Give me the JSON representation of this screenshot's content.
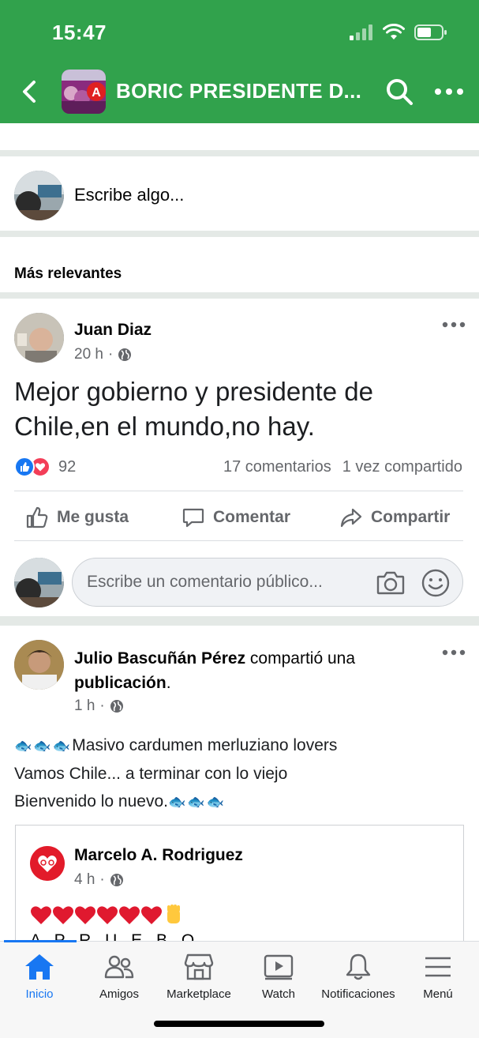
{
  "status_bar": {
    "time": "15:47"
  },
  "header": {
    "group_title": "BORIC PRESIDENTE D..."
  },
  "composer": {
    "placeholder": "Escribe algo..."
  },
  "feed": {
    "section_title": "Más relevantes"
  },
  "post1": {
    "author": "Juan Diaz",
    "time": "20 h",
    "text": "Mejor gobierno y presidente de Chile,en el mundo,no hay.",
    "reaction_count": "92",
    "comments": "17 comentarios",
    "shares": "1 vez compartido"
  },
  "actions": {
    "like": "Me gusta",
    "comment": "Comentar",
    "share": "Compartir"
  },
  "comment_box": {
    "placeholder": "Escribe un comentario público..."
  },
  "post2": {
    "author": "Julio Bascuñán Pérez",
    "shared_text": "compartió una",
    "shared_object": "publicación",
    "time": "1 h",
    "line1": "Masivo  cardumen merluziano lovers",
    "line2": "Vamos Chile... a terminar con lo viejo",
    "line3": "Bienvenido lo nuevo."
  },
  "shared_post": {
    "author": "Marcelo A. Rodriguez",
    "time": "4 h",
    "text": "A P R U E B O"
  },
  "tabbar": {
    "tabs": [
      {
        "label": "Inicio",
        "icon": "home-icon",
        "active": true
      },
      {
        "label": "Amigos",
        "icon": "friends-icon"
      },
      {
        "label": "Marketplace",
        "icon": "marketplace-icon"
      },
      {
        "label": "Watch",
        "icon": "watch-icon"
      },
      {
        "label": "Notificaciones",
        "icon": "bell-icon"
      },
      {
        "label": "Menú",
        "icon": "menu-icon"
      }
    ]
  },
  "colors": {
    "header_green": "#31a24c",
    "accent_blue": "#1877f2",
    "love_red": "#f33e58"
  }
}
